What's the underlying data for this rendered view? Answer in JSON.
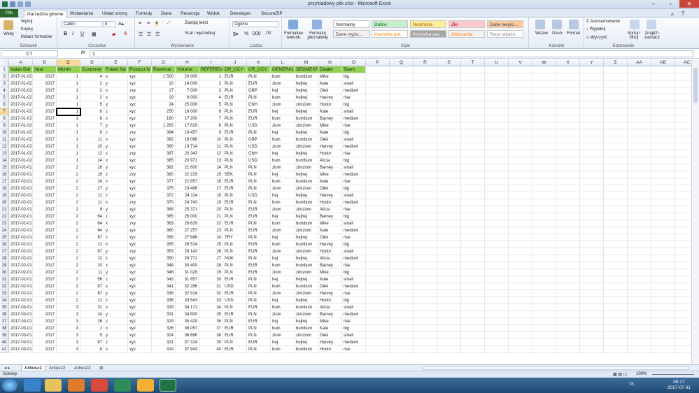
{
  "window": {
    "title": "przykladowy plik.xlsx - Microsoft Excel"
  },
  "ribbon_tabs": [
    "Plik",
    "Narzędzia główne",
    "Wstawianie",
    "Układ strony",
    "Formuły",
    "Dane",
    "Recenzja",
    "Widok",
    "Developer",
    "SecureZIP"
  ],
  "ribbon": {
    "paste_label": "Wklej",
    "cut_label": "Wytnij",
    "copy_label": "Kopiuj",
    "format_painter_label": "Malarz formatów",
    "clipboard_group": "Schowek",
    "font_name": "Calibri",
    "font_size": "8",
    "font_group": "Czcionka",
    "wrap_text_label": "Zawijaj tekst",
    "merge_label": "Scal i wyśrodkuj",
    "alignment_group": "Wyrównanie",
    "number_format": "Ogólne",
    "number_group": "Liczba",
    "cond_format_label": "Formatow. warunk.",
    "format_table_label": "Formatuj jako tabelę",
    "styles": [
      {
        "label": "Normalny",
        "bg": "#ffffff",
        "color": "#222222"
      },
      {
        "label": "Dobre",
        "bg": "#c6efce",
        "color": "#006100"
      },
      {
        "label": "Neutralne",
        "bg": "#ffeb9c",
        "color": "#9c6500"
      },
      {
        "label": "Złe",
        "bg": "#ffc7ce",
        "color": "#9c0006"
      },
      {
        "label": "Dane wejści...",
        "bg": "#ffcc99",
        "color": "#3f3f76"
      },
      {
        "label": "Dane wyjśc...",
        "bg": "#f2f2f2",
        "color": "#3f3f3f"
      },
      {
        "label": "Komórka poł...",
        "bg": "#ffffff",
        "color": "#fa7d00"
      },
      {
        "label": "Komórka zaz...",
        "bg": "#a5a5a5",
        "color": "#ffffff"
      },
      {
        "label": "Obliczenia",
        "bg": "#f2f2f2",
        "color": "#fa7d00"
      },
      {
        "label": "Tekst objaśn...",
        "bg": "#ffffff",
        "color": "#7f7f7f"
      }
    ],
    "styles_group": "Style",
    "insert_label": "Wstaw",
    "delete_label": "Usuń",
    "format_label": "Format",
    "cells_group": "Komórki",
    "autosum_label": "Autosumowanie",
    "fill_label": "Wypełnij",
    "clear_label": "Wyczyść",
    "sort_label": "Sortuj i filtruj",
    "find_label": "Znajdź i zaznacz",
    "editing_group": "Edytowanie"
  },
  "formula_bar": {
    "name_box": "C7",
    "fx": "fx",
    "value": "1"
  },
  "columns": [
    "A",
    "B",
    "C",
    "D",
    "E",
    "F",
    "G",
    "H",
    "I",
    "J",
    "K",
    "L",
    "M",
    "N",
    "O",
    "P",
    "Q",
    "R",
    "S",
    "T",
    "U",
    "V",
    "W",
    "X",
    "Y",
    "Z",
    "AA",
    "AB",
    "AC"
  ],
  "header_row": [
    "Value Dat",
    "Year",
    "Month",
    "Customer",
    "Folder Na",
    "Product N",
    "Revenue",
    "Volume",
    "REFERENCE",
    "DR_CCY",
    "CR_CCY",
    "GENERAL_",
    "SEGMENT",
    "Dealer",
    "Team"
  ],
  "rows": [
    [
      "2017-01-02",
      "2017",
      "1",
      "4",
      "x",
      "xyz",
      "1 500",
      "20 000",
      "1",
      "EUR",
      "PLN",
      "bum",
      "bumbum",
      "Mike",
      "big"
    ],
    [
      "2017-01-02",
      "2017",
      "1",
      "2",
      "y",
      "xyz",
      "10",
      "14 000",
      "2",
      "PLN",
      "EUR",
      "ziom",
      "hejhej",
      "Kate",
      "small"
    ],
    [
      "2017-01-02",
      "2017",
      "1",
      "2",
      "x",
      "zxy",
      "17",
      "7 000",
      "3",
      "PLN",
      "GBP",
      "hej",
      "hejhej",
      "Olek",
      "medium"
    ],
    [
      "2017-01-02",
      "2017",
      "1",
      "2",
      "x",
      "xyz",
      "19",
      "6 000",
      "4",
      "EUR",
      "PLN",
      "bum",
      "hejhej",
      "Harvey",
      "rise"
    ],
    [
      "2017-01-02",
      "2017",
      "1",
      "5",
      "y",
      "xyz",
      "24",
      "25 000",
      "5",
      "PLN",
      "CNH",
      "ziom",
      "zimziom",
      "Hodor",
      "big"
    ],
    [
      "2017-01-02",
      "2017",
      "1",
      "6",
      "z",
      "xyz",
      "250",
      "18 000",
      "6",
      "PLN",
      "EUR",
      "hej",
      "hejhej",
      "Kate",
      "small"
    ],
    [
      "2017-01-02",
      "2017",
      "1",
      "8",
      "x",
      "xyz",
      "160",
      "17 200",
      "7",
      "PLN",
      "EUR",
      "bum",
      "bumbum",
      "Barney",
      "medium"
    ],
    [
      "2017-01-02",
      "2017",
      "1",
      "7",
      "y",
      "xyz",
      "1 263",
      "17 829",
      "8",
      "PLN",
      "USD",
      "ziom",
      "zimziom",
      "Mike",
      "rise"
    ],
    [
      "2017-01-02",
      "2017",
      "1",
      "9",
      "z",
      "zxy",
      "394",
      "18 457",
      "9",
      "EUR",
      "PLN",
      "hej",
      "hejhej",
      "Kate",
      "big"
    ],
    [
      "2017-01-02",
      "2017",
      "1",
      "11",
      "x",
      "xyz",
      "392",
      "19 086",
      "10",
      "PLN",
      "GBP",
      "bum",
      "bumbum",
      "Olek",
      "small"
    ],
    [
      "2017-01-02",
      "2017",
      "1",
      "10",
      "y",
      "xyz",
      "390",
      "19 714",
      "11",
      "PLN",
      "USD",
      "ziom",
      "zimziom",
      "Harvey",
      "medium"
    ],
    [
      "2017-01-02",
      "2017",
      "1",
      "12",
      "z",
      "zxy",
      "387",
      "20 343",
      "12",
      "PLN",
      "CNH",
      "hej",
      "hejhej",
      "Hodor",
      "rise"
    ],
    [
      "2017-01-02",
      "2017",
      "1",
      "14",
      "x",
      "xyz",
      "385",
      "20 971",
      "13",
      "PLN",
      "USD",
      "bum",
      "bumbum",
      "Alicia",
      "big"
    ],
    [
      "2017-02-01",
      "2017",
      "2",
      "16",
      "y",
      "xyz",
      "382",
      "21 600",
      "14",
      "PLN",
      "PLN",
      "ziom",
      "zimziom",
      "Barney",
      "small"
    ],
    [
      "2017-02-01",
      "2017",
      "2",
      "19",
      "z",
      "zxy",
      "380",
      "22 229",
      "15",
      "SEK",
      "PLN",
      "hej",
      "hejhej",
      "Mike",
      "medium"
    ],
    [
      "2017-02-01",
      "2017",
      "2",
      "24",
      "x",
      "xyz",
      "377",
      "22 857",
      "16",
      "EUR",
      "PLN",
      "bum",
      "bumbum",
      "Kate",
      "rise"
    ],
    [
      "2017-02-01",
      "2017",
      "2",
      "27",
      "y",
      "xyz",
      "375",
      "23 486",
      "17",
      "EUR",
      "PLN",
      "ziom",
      "zimziom",
      "Olek",
      "big"
    ],
    [
      "2017-02-01",
      "2017",
      "2",
      "11",
      "z",
      "xyz",
      "372",
      "24 114",
      "18",
      "PLN",
      "USD",
      "hej",
      "hejhej",
      "Harvey",
      "small"
    ],
    [
      "2017-02-01",
      "2017",
      "2",
      "11",
      "x",
      "zxy",
      "370",
      "24 743",
      "19",
      "EUR",
      "PLN",
      "bum",
      "bumbum",
      "Hodor",
      "medium"
    ],
    [
      "2017-02-01",
      "2017",
      "2",
      "9",
      "y",
      "xyz",
      "368",
      "25 371",
      "20",
      "PLN",
      "EUR",
      "ziom",
      "zimziom",
      "Alicia",
      "rise"
    ],
    [
      "2017-02-01",
      "2017",
      "2",
      "64",
      "z",
      "xyz",
      "365",
      "26 000",
      "21",
      "PLN",
      "EUR",
      "hej",
      "hejhej",
      "Barney",
      "big"
    ],
    [
      "2017-02-01",
      "2017",
      "2",
      "64",
      "x",
      "zxy",
      "363",
      "26 629",
      "22",
      "EUR",
      "PLN",
      "bum",
      "bumbum",
      "Mike",
      "small"
    ],
    [
      "2017-02-01",
      "2017",
      "2",
      "64",
      "y",
      "xyz",
      "360",
      "27 257",
      "23",
      "PLN",
      "EUR",
      "ziom",
      "zimziom",
      "Kate",
      "medium"
    ],
    [
      "2017-02-01",
      "2017",
      "2",
      "87",
      "z",
      "xyz",
      "358",
      "27 886",
      "24",
      "TRY",
      "PLN",
      "hej",
      "hejhej",
      "Olek",
      "rise"
    ],
    [
      "2017-02-01",
      "2017",
      "2",
      "11",
      "x",
      "xyz",
      "355",
      "28 514",
      "25",
      "PLN",
      "EUR",
      "bum",
      "bumbum",
      "Harvey",
      "big"
    ],
    [
      "2017-02-01",
      "2017",
      "2",
      "87",
      "y",
      "zxy",
      "353",
      "29 143",
      "26",
      "PLN",
      "EUR",
      "ziom",
      "zimziom",
      "Hodor",
      "small"
    ],
    [
      "2017-02-01",
      "2017",
      "2",
      "12",
      "z",
      "xyz",
      "350",
      "29 771",
      "27",
      "NOK",
      "PLN",
      "hej",
      "hejhej",
      "Alicia",
      "medium"
    ],
    [
      "2017-02-01",
      "2017",
      "2",
      "10",
      "x",
      "xyz",
      "348",
      "30 400",
      "28",
      "PLN",
      "EUR",
      "bum",
      "bumbum",
      "Barney",
      "rise"
    ],
    [
      "2017-02-01",
      "2017",
      "2",
      "11",
      "y",
      "xyz",
      "346",
      "31 029",
      "29",
      "PLN",
      "EUR",
      "ziom",
      "zimziom",
      "Mike",
      "big"
    ],
    [
      "2017-02-01",
      "2017",
      "2",
      "56",
      "z",
      "xyz",
      "343",
      "31 657",
      "30",
      "EUR",
      "PLN",
      "hej",
      "hejhej",
      "Kate",
      "small"
    ],
    [
      "2017-02-01",
      "2017",
      "2",
      "87",
      "x",
      "xyz",
      "341",
      "32 286",
      "31",
      "USD",
      "PLN",
      "bum",
      "bumbum",
      "Olek",
      "medium"
    ],
    [
      "2017-02-01",
      "2017",
      "2",
      "87",
      "y",
      "xyz",
      "338",
      "32 914",
      "32",
      "EUR",
      "PLN",
      "ziom",
      "zimziom",
      "Harvey",
      "rise"
    ],
    [
      "2017-02-01",
      "2017",
      "2",
      "11",
      "z",
      "xyz",
      "336",
      "33 543",
      "33",
      "USD",
      "PLN",
      "hej",
      "hejhej",
      "Hodor",
      "big"
    ],
    [
      "2017-03-01",
      "2017",
      "3",
      "31",
      "x",
      "xyz",
      "333",
      "34 171",
      "34",
      "PLN",
      "EUR",
      "bum",
      "bumbum",
      "Alicia",
      "small"
    ],
    [
      "2017-03-01",
      "2017",
      "3",
      "24",
      "y",
      "xyz",
      "331",
      "34 800",
      "35",
      "EUR",
      "PLN",
      "ziom",
      "zimziom",
      "Barney",
      "medium"
    ],
    [
      "2017-03-01",
      "2017",
      "3",
      "26",
      "z",
      "xyz",
      "329",
      "35 429",
      "36",
      "PLN",
      "EUR",
      "hej",
      "hejhej",
      "Mike",
      "rise"
    ],
    [
      "2017-03-01",
      "2017",
      "3",
      "1",
      "x",
      "xyz",
      "326",
      "36 057",
      "37",
      "EUR",
      "PLN",
      "bum",
      "bumbum",
      "Kate",
      "big"
    ],
    [
      "2017-03-01",
      "2017",
      "3",
      "5",
      "y",
      "xyz",
      "324",
      "36 686",
      "38",
      "EUR",
      "PLN",
      "ziom",
      "zimziom",
      "Olek",
      "small"
    ],
    [
      "2017-03-01",
      "2017",
      "3",
      "87",
      "z",
      "xyz",
      "321",
      "37 314",
      "39",
      "PLN",
      "EUR",
      "hej",
      "hejhej",
      "Harvey",
      "medium"
    ],
    [
      "2017-03-01",
      "2017",
      "3",
      "8",
      "x",
      "xyz",
      "319",
      "37 943",
      "40",
      "EUR",
      "PLN",
      "bum",
      "bumbum",
      "Hodor",
      "rise"
    ]
  ],
  "sheets": [
    "Arkusz1",
    "Arkusz2",
    "Arkusz3"
  ],
  "status": {
    "ready": "Gotowy",
    "zoom": "100%"
  },
  "taskbar": {
    "lang": "PL",
    "time": "09:17",
    "date": "2017-07-31"
  },
  "colors": {
    "header_fill": "#92d050",
    "accent": "#2a6a2f",
    "selection": "#f9d99b"
  }
}
